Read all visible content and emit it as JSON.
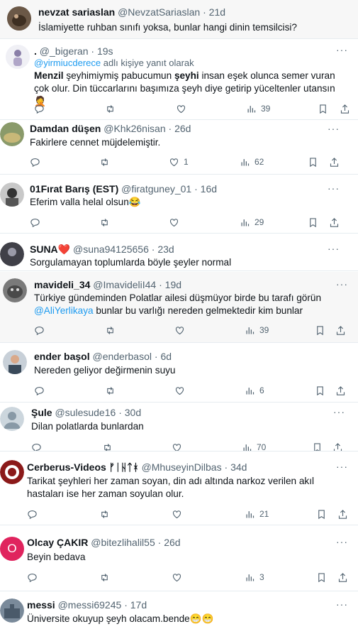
{
  "tweets": [
    {
      "name": "nevzat sariaslan",
      "handle": "@NevzatSariaslan",
      "time": "21d",
      "text": "İslamiyette ruhban sınıfı yoksa, bunlar hangi dinin temsilcisi?"
    },
    {
      "name": ".",
      "handle": "@_bigeran",
      "time": "19s",
      "reply_to": "@yirmiucderece",
      "reply_suffix": "adlı kişiye yanıt olarak",
      "text_bold1": "Menzil",
      "text_mid1": " şeyhimiymiş pabucumun ",
      "text_bold2": "şeyhi",
      "text_rest": " insan eşek olunca semer vuran çok olur. Din tüccarlarını başımıza şeyh diye getirip yüceltenler utansın 🤦",
      "views": "39"
    },
    {
      "name": "Damdan düşen",
      "handle": "@Khk26nisan",
      "time": "26d",
      "text": "Fakirlere cennet müjdelemiştir.",
      "likes": "1",
      "views": "62"
    },
    {
      "name": "01Fırat Barış (EST)",
      "handle": "@firatguney_01",
      "time": "16d",
      "text": "Eferim valla helal olsun😂",
      "views": "29"
    },
    {
      "name": "SUNA❤️",
      "handle": "@suna94125656",
      "time": "23d",
      "text": "Sorgulamayan toplumlarda böyle şeyler normal"
    },
    {
      "name": "mavideli_34",
      "handle": "@ImavideliI44",
      "time": "19d",
      "text": "Türkiye gündeminden Polatlar ailesi düşmüyor birde bu tarafı görün",
      "mention": "@AliYerlikaya",
      "text2": " bunlar bu varlığı nereden gelmektedir kim bunlar",
      "views": "39"
    },
    {
      "name": "ender başol",
      "handle": "@enderbasol",
      "time": "6d",
      "text": "Nereden geliyor değirmenin suyu",
      "views": "6"
    },
    {
      "name": "Şule",
      "handle": "@sulesude16",
      "time": "30d",
      "text": "Dilan polatlarda bunlardan",
      "views": "70"
    },
    {
      "name": "Cerberus-Videos ᚠᛁᚺᛏᚼ",
      "handle": "@MhuseyinDilbas",
      "time": "34d",
      "text": "Tarikat şeyhleri her zaman soyan, din adı altında narkoz verilen akıl hastaları ise her zaman soyulan olur.",
      "views": "21"
    },
    {
      "name": "Olcay ÇAKIR",
      "handle": "@bitezlihalil55",
      "time": "26d",
      "text": "Beyin bedava",
      "views": "3",
      "avatar_letter": "O"
    },
    {
      "name": "messi",
      "handle": "@messi69245",
      "time": "17d",
      "text": "Üniversite okuyup şeyh olacam.bende😁😁"
    }
  ],
  "more_label": "···",
  "dot": "·",
  "colors": {
    "link": "#1d9bf0",
    "muted": "#536471",
    "olcay_avatar": "#e0245e"
  }
}
